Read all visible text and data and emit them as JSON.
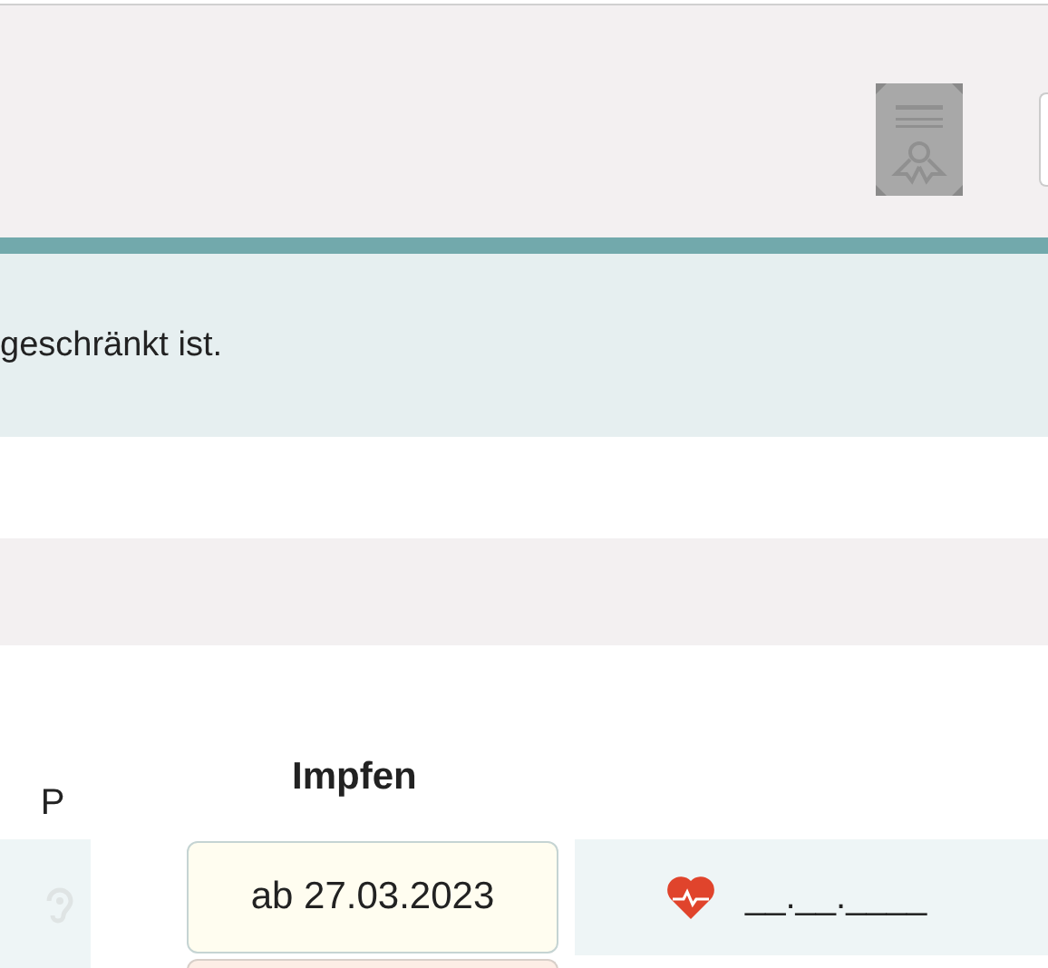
{
  "info_text": "geschränkt ist.",
  "columns": [
    {
      "label": "P"
    },
    {
      "label": "Impfen"
    }
  ],
  "row": {
    "date_from": "ab 27.03.2023",
    "date_input": "__.__.____"
  }
}
